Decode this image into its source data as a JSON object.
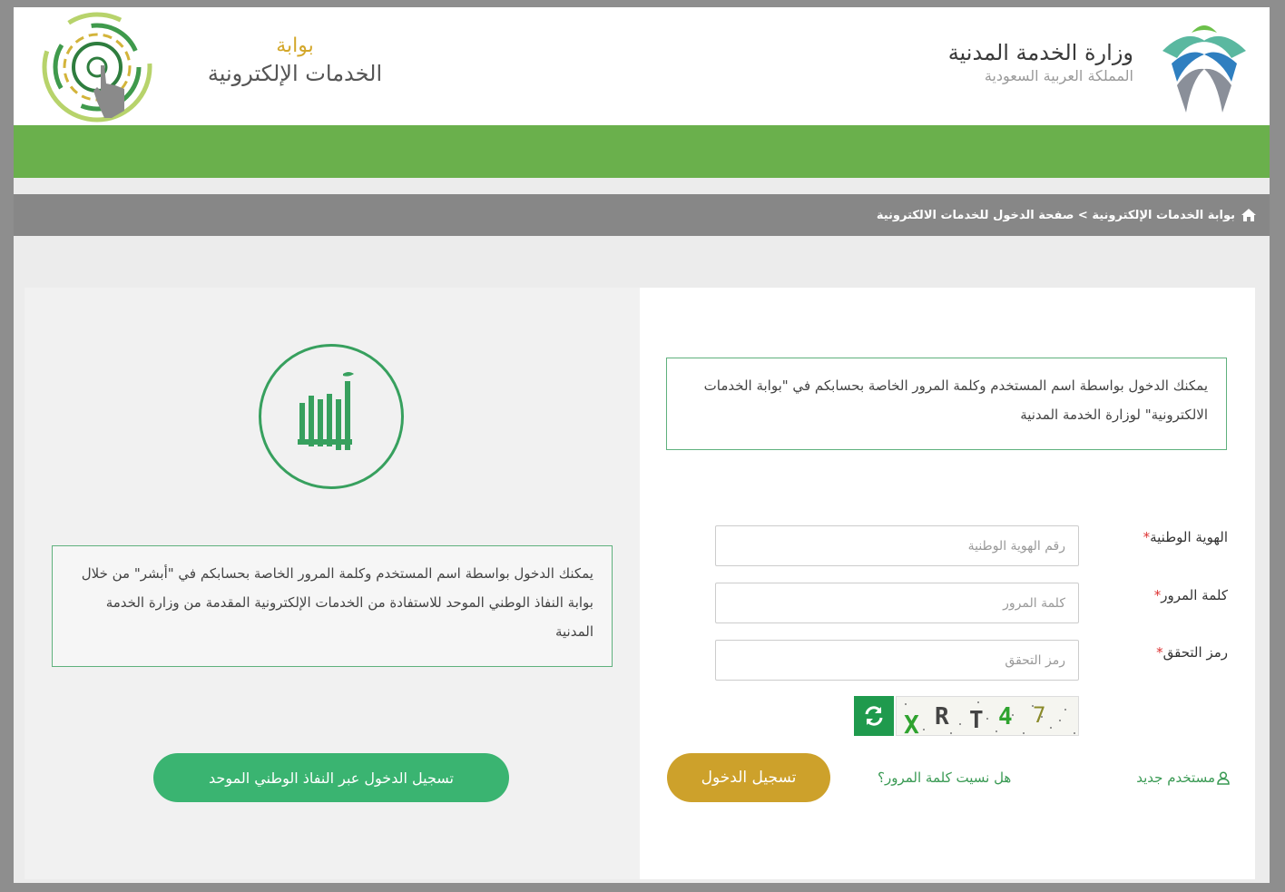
{
  "header": {
    "portal_line1": "بوابة",
    "portal_line2": "الخدمات الإلكترونية",
    "ministry_name": "وزارة الخدمة المدنية",
    "country": "المملكة العربية السعودية"
  },
  "breadcrumb": {
    "home_icon": "home-icon",
    "text": "بوابة الخدمات الإلكترونية > صفحة الدخول للخدمات الالكترونية"
  },
  "absher": {
    "logo_text": "أبشر",
    "info": "يمكنك الدخول بواسطة اسم المستخدم وكلمة المرور الخاصة بحسابكم في \"أبشر\" من خلال بوابة النفاذ الوطني الموحد للاستفادة من الخدمات الإلكترونية المقدمة من وزارة الخدمة المدنية",
    "nafath_button": "تسجيل الدخول عبر النفاذ الوطني الموحد"
  },
  "login": {
    "info": "يمكنك الدخول بواسطة اسم المستخدم وكلمة المرور الخاصة بحسابكم في \"بوابة الخدمات الالكترونية\" لوزارة الخدمة المدنية",
    "national_id_label": "الهوية الوطنية",
    "national_id_placeholder": "رقم الهوية الوطنية",
    "password_label": "كلمة المرور",
    "password_placeholder": "كلمة المرور",
    "captcha_label": "رمز التحقق",
    "captcha_placeholder": "رمز التحقق",
    "captcha_text": "XRT47",
    "required_mark": "*",
    "login_button": "تسجيل الدخول",
    "forgot_password": "هل نسيت كلمة المرور؟",
    "new_user": "مستخدم جديد"
  },
  "colors": {
    "green_bar": "#6ab04c",
    "button_green": "#3ab471",
    "button_gold": "#cda12b",
    "breadcrumb_gray": "#878787"
  }
}
